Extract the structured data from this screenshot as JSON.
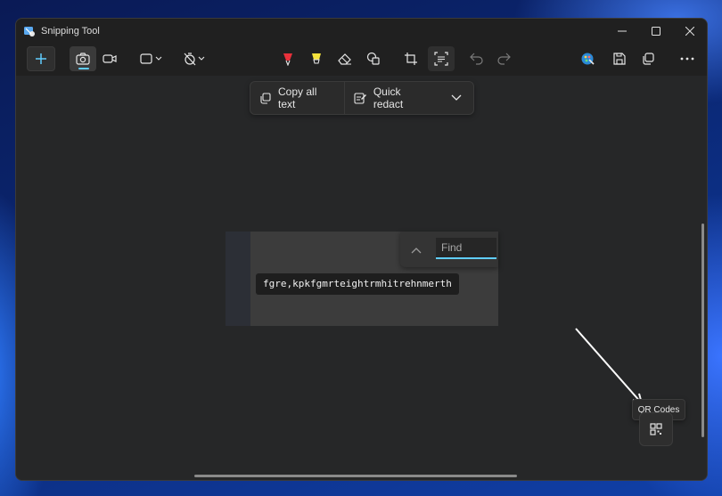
{
  "titlebar": {
    "title": "Snipping Tool"
  },
  "window_controls": [
    "minimize",
    "maximize",
    "close"
  ],
  "toolbar": {
    "new_icon": "plus-icon",
    "modes": [
      "camera-icon",
      "video-icon"
    ],
    "selected_mode": "camera-icon",
    "tools": [
      "rectangle-snip-icon",
      "timer-off-icon",
      "ballpoint-pen-icon",
      "highlighter-icon",
      "eraser-icon",
      "shapes-icon",
      "crop-icon",
      "text-actions-icon",
      "undo-icon",
      "redo-icon",
      "paint-icon",
      "save-icon",
      "copy-icon",
      "more-icon"
    ],
    "pen_color": "#e8313b",
    "highlighter_color": "#f4e23b"
  },
  "text_actions": {
    "copy_all_label": "Copy all text",
    "quick_redact_label": "Quick redact"
  },
  "capture": {
    "detected_text": "fgre,kpkfgmrteightrmhitrehnmerth",
    "find_placeholder": "Find"
  },
  "qr": {
    "tooltip": "QR Codes"
  },
  "colors": {
    "accent": "#60cdff",
    "window_bg": "#262728",
    "titlebar_bg": "#202020"
  }
}
